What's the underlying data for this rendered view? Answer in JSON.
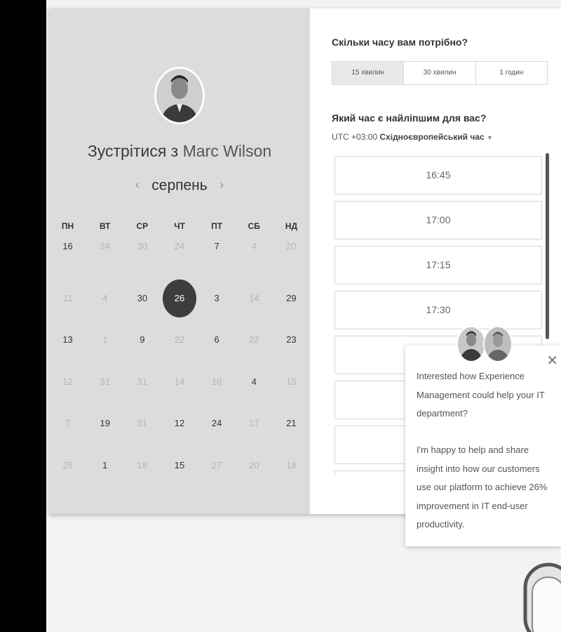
{
  "meeting": {
    "title_prefix": "Зустрітися з",
    "host_name": "Marc Wilson"
  },
  "calendar": {
    "month": "серпень",
    "prev_icon": "chevron-left-icon",
    "next_icon": "chevron-right-icon",
    "weekdays": [
      "ПН",
      "ВТ",
      "СР",
      "ЧТ",
      "ПТ",
      "СБ",
      "НД"
    ],
    "days": [
      {
        "n": "16",
        "on": true
      },
      {
        "n": "24",
        "on": false
      },
      {
        "n": "30",
        "on": false
      },
      {
        "n": "24",
        "on": false
      },
      {
        "n": "7",
        "on": true
      },
      {
        "n": "4",
        "on": false
      },
      {
        "n": "20",
        "on": false
      },
      {
        "n": "11",
        "on": false
      },
      {
        "n": "4",
        "on": false
      },
      {
        "n": "30",
        "on": true
      },
      {
        "n": "26",
        "on": true,
        "selected": true
      },
      {
        "n": "3",
        "on": true
      },
      {
        "n": "14",
        "on": false
      },
      {
        "n": "29",
        "on": true
      },
      {
        "n": "13",
        "on": true
      },
      {
        "n": "1",
        "on": false
      },
      {
        "n": "9",
        "on": true
      },
      {
        "n": "22",
        "on": false
      },
      {
        "n": "6",
        "on": true
      },
      {
        "n": "22",
        "on": false
      },
      {
        "n": "23",
        "on": true
      },
      {
        "n": "12",
        "on": false
      },
      {
        "n": "31",
        "on": false
      },
      {
        "n": "31",
        "on": false
      },
      {
        "n": "14",
        "on": false
      },
      {
        "n": "10",
        "on": false
      },
      {
        "n": "4",
        "on": true
      },
      {
        "n": "15",
        "on": false
      },
      {
        "n": "7",
        "on": false
      },
      {
        "n": "19",
        "on": true
      },
      {
        "n": "31",
        "on": false
      },
      {
        "n": "12",
        "on": true
      },
      {
        "n": "24",
        "on": true
      },
      {
        "n": "17",
        "on": false
      },
      {
        "n": "21",
        "on": true
      },
      {
        "n": "26",
        "on": false
      },
      {
        "n": "1",
        "on": true
      },
      {
        "n": "18",
        "on": false
      },
      {
        "n": "15",
        "on": true
      },
      {
        "n": "27",
        "on": false
      },
      {
        "n": "20",
        "on": false
      },
      {
        "n": "18",
        "on": false
      }
    ]
  },
  "duration": {
    "question": "Скільки часу вам потрібно?",
    "options": [
      "15 хвилин",
      "30 хвилин",
      "1 годин"
    ],
    "selected_index": 0
  },
  "time": {
    "question": "Який час є найліпшим для вас?",
    "tz_offset": "UTC +03:00",
    "tz_name": "Східноєвропейський час",
    "slots": [
      "16:45",
      "17:00",
      "17:15",
      "17:30",
      "",
      "",
      "",
      ""
    ]
  },
  "popup": {
    "text1": "Interested how Experience Management could help your IT department?",
    "text2": "I'm happy to help and share insight into how our customers use our platform to achieve 26% improvement in IT end-user productivity.",
    "close_icon": "close-icon"
  },
  "colors": {
    "calendar_bg": "#dcdcdc",
    "selected_day": "#3d3d3d",
    "page_bg": "#f3f3f3"
  }
}
